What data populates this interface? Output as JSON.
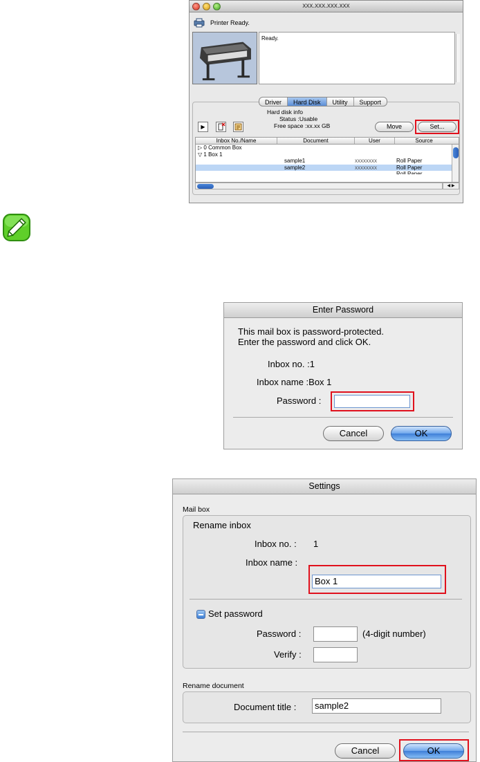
{
  "printer_window": {
    "title": "xxx.xxx.xxx.xxx",
    "status_text": "Printer Ready.",
    "ready_message": "Ready.",
    "tabs": [
      {
        "label": "Driver",
        "active": false
      },
      {
        "label": "Hard Disk",
        "active": true
      },
      {
        "label": "Utility",
        "active": false
      },
      {
        "label": "Support",
        "active": false
      }
    ],
    "hd_info": {
      "title": "Hard disk info",
      "status": "Status :Usable",
      "free_space": "Free space :xx.xx GB"
    },
    "move_button": "Move",
    "set_button": "Set...",
    "table": {
      "columns": [
        "Inbox No./Name",
        "Document",
        "User",
        "Source"
      ],
      "rows": [
        {
          "name": "0 Common Box",
          "document": "",
          "user": "",
          "source": "",
          "expander": "▷",
          "selected": false
        },
        {
          "name": "1 Box 1",
          "document": "",
          "user": "",
          "source": "",
          "expander": "▽",
          "selected": false
        },
        {
          "name": "",
          "document": "sample1",
          "user": "xxxxxxxx",
          "source": "Roll Paper",
          "expander": "",
          "selected": false
        },
        {
          "name": "",
          "document": "sample2",
          "user": "xxxxxxxx",
          "source": "Roll Paper",
          "expander": "",
          "selected": true
        },
        {
          "name": "",
          "document": "",
          "user": "",
          "source": "Roll Paper",
          "expander": "",
          "selected": false
        }
      ]
    }
  },
  "enter_password_dialog": {
    "title": "Enter Password",
    "message_line1": "This mail box is password-protected.",
    "message_line2": "Enter the password and click OK.",
    "inbox_no": "Inbox no. :1",
    "inbox_name": "Inbox name :Box 1",
    "password_label": "Password :",
    "password_value": "",
    "cancel_button": "Cancel",
    "ok_button": "OK"
  },
  "settings_dialog": {
    "title": "Settings",
    "mail_box_caption": "Mail box",
    "rename_inbox_label": "Rename inbox",
    "inbox_no_label": "Inbox no. :",
    "inbox_no_value": "1",
    "inbox_name_label": "Inbox name :",
    "inbox_name_value": "Box 1",
    "set_password_label": "Set password",
    "password_label": "Password :",
    "password_hint": "(4-digit number)",
    "verify_label": "Verify :",
    "rename_document_caption": "Rename document",
    "document_title_label": "Document title :",
    "document_title_value": "sample2",
    "cancel_button": "Cancel",
    "ok_button": "OK"
  },
  "colors": {
    "highlight_outline": "#e0101c",
    "selection": "#bcd6f5",
    "aqua_blue": "#3f7fd8"
  }
}
